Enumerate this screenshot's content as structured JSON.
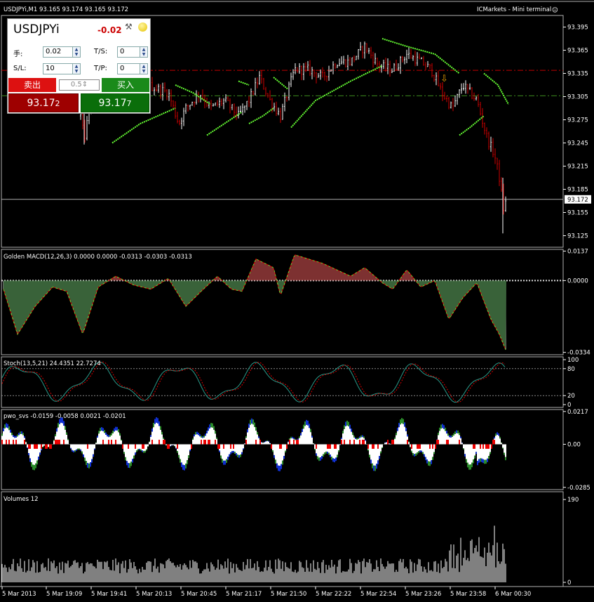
{
  "header": {
    "symbol_info": "USDJPYi,M1  93.165 93.174 93.165 93.172",
    "broker": "ICMarkets - Mini terminal",
    "smiley": "☺"
  },
  "one_click": {
    "symbol": "USDJPYi",
    "change": "-0.02",
    "lot_label": "手:",
    "lot_value": "0.02",
    "ts_label": "T/S:",
    "ts_value": "0",
    "sl_label": "S/L:",
    "sl_value": "10",
    "tp_label": "T/P:",
    "tp_value": "0",
    "sell_label": "卖出",
    "buy_label": "买入",
    "volume_value": "0.5",
    "sell_price_main": "93.17",
    "sell_price_last": "2",
    "buy_price_main": "93.17",
    "buy_price_last": "7"
  },
  "colors": {
    "background": "#000000",
    "bull_bar": "#ffffff",
    "bear_bar": "#d00000",
    "trend_line": "#66ff33",
    "red_level": "#c00000",
    "green_level": "#3c8c1e",
    "macd_up": "#8b0000",
    "macd_down": "#0f5a0f"
  },
  "chart_data": [
    {
      "type": "candlestick",
      "panel": "price",
      "y_ticks": [
        "93.395",
        "93.365",
        "93.335",
        "93.305",
        "93.275",
        "93.245",
        "93.215",
        "93.185",
        "93.155",
        "93.125"
      ],
      "ylim": [
        93.11,
        93.41
      ],
      "current_price": "93.172",
      "levels": {
        "red_dashdot": 93.339,
        "green_dashdot": 93.306,
        "gray": 93.172
      },
      "arrow_marker": "⇩"
    },
    {
      "type": "histogram",
      "panel": "macd",
      "title": "Golden MACD(12,26,3) 0.0000 0.0000 -0.0313 -0.0303 -0.0313",
      "y_ticks": [
        "0.0137",
        "0.0000",
        "-0.0334"
      ],
      "ylim": [
        -0.0345,
        0.0145
      ]
    },
    {
      "type": "line",
      "panel": "stochastic",
      "title": "Stoch(13,5,21) 24.4351 22.7274",
      "y_ticks": [
        "100",
        "80",
        "20",
        "0"
      ],
      "ylim": [
        0,
        100
      ]
    },
    {
      "type": "histogram",
      "panel": "pwo_svs",
      "title": "pwo_svs -0.0159 -0.0058 0.0021 -0.0201",
      "y_ticks": [
        "0.0217",
        "0.00",
        "-0.0285"
      ],
      "ylim": [
        -0.03,
        0.023
      ]
    },
    {
      "type": "bar",
      "panel": "volumes",
      "title": "Volumes 12",
      "y_ticks": [
        "190",
        "0"
      ],
      "ylim": [
        0,
        195
      ]
    }
  ],
  "x_ticks": [
    "5 Mar 2013",
    "5 Mar 19:09",
    "5 Mar 19:41",
    "5 Mar 20:13",
    "5 Mar 20:45",
    "5 Mar 21:17",
    "5 Mar 21:50",
    "5 Mar 22:22",
    "5 Mar 22:54",
    "5 Mar 23:26",
    "5 Mar 23:58",
    "6 Mar 00:30"
  ]
}
